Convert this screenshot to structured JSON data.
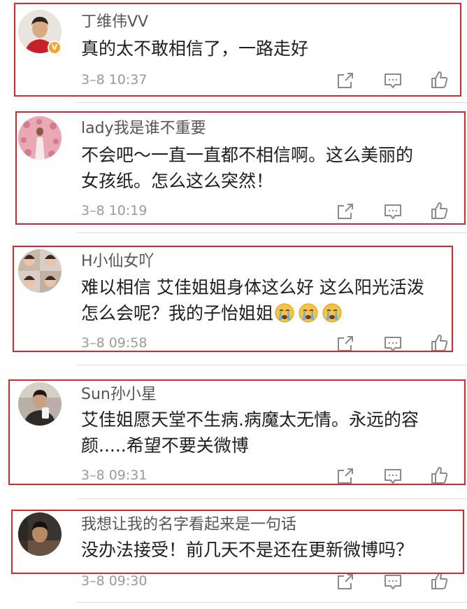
{
  "comments": [
    {
      "username": "丁维伟VV",
      "verified": true,
      "lines": [
        "真的太不敢相信了，一路走好"
      ],
      "time": "3–8 10:37"
    },
    {
      "username": "lady我是谁不重要",
      "verified": false,
      "lines": [
        "不会吧～一直一直都不相信啊。这么美丽的",
        "女孩纸。怎么这么突然！"
      ],
      "time": "3–8 10:19"
    },
    {
      "username": "H小仙女吖",
      "verified": false,
      "lines": [
        "难以相信 艾佳姐姐身体这么好 这么阳光活泼",
        "怎么会呢？我的子怡姐姐"
      ],
      "emoji": [
        "crying-face-emoji",
        "crying-face-emoji",
        "crying-face-emoji"
      ],
      "time": "3–8 09:58"
    },
    {
      "username": "Sun孙小星",
      "verified": false,
      "lines": [
        "艾佳姐愿天堂不生病.病魔太无情。永远的容",
        "颜.....希望不要关微博"
      ],
      "time": "3–8 09:31"
    },
    {
      "username": "我想让我的名字看起来是一句话",
      "verified": false,
      "lines": [
        "没办法接受！前几天不是还在更新微博吗？"
      ],
      "time": "3–8 09:30"
    }
  ],
  "icons": {
    "share": "share-icon",
    "comment": "comment-icon",
    "like": "thumbs-up-icon",
    "verified": "verified-badge-icon"
  },
  "colors": {
    "highlight": "#d9262f",
    "badge": "#f5a623",
    "muted_text": "#9a9a9a",
    "icon": "#8a8a8a"
  }
}
